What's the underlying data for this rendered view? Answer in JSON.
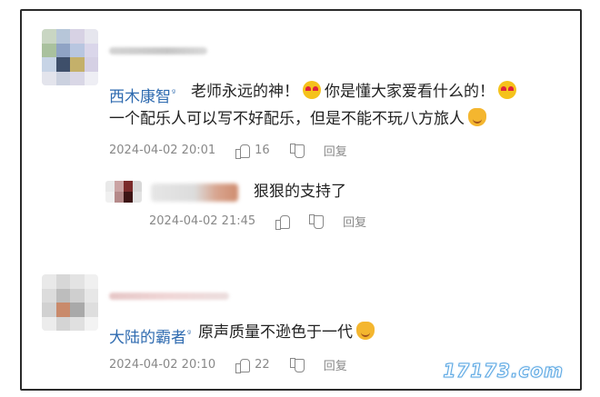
{
  "comments": [
    {
      "username": "西木康智",
      "verified_badge": "ᵍ",
      "lines": [
        [
          "老师永远的神！",
          "heart-eyes-emoji",
          "你是懂大家爱看什么的！",
          "heart-eyes-emoji"
        ],
        [
          "一个配乐人可以写不好配乐，但是不能不玩八方旅人",
          "cat-emoji"
        ]
      ],
      "time": "2024-04-02 20:01",
      "likes": "16",
      "reply_label": "回复"
    },
    {
      "is_reply": true,
      "text": "狠狠的支持了",
      "time": "2024-04-02 21:45",
      "reply_label": "回复"
    },
    {
      "username": "大陆的霸者",
      "verified_badge": "ᵍ",
      "text": "原声质量不逊色于一代",
      "trailing_emoji": "cat-emoji",
      "time": "2024-04-02 20:10",
      "likes": "22",
      "reply_label": "回复"
    }
  ],
  "watermark": "17173.com",
  "colors": {
    "username": "#2f6bb0",
    "meta": "#888888",
    "border": "#2a2a2a"
  }
}
